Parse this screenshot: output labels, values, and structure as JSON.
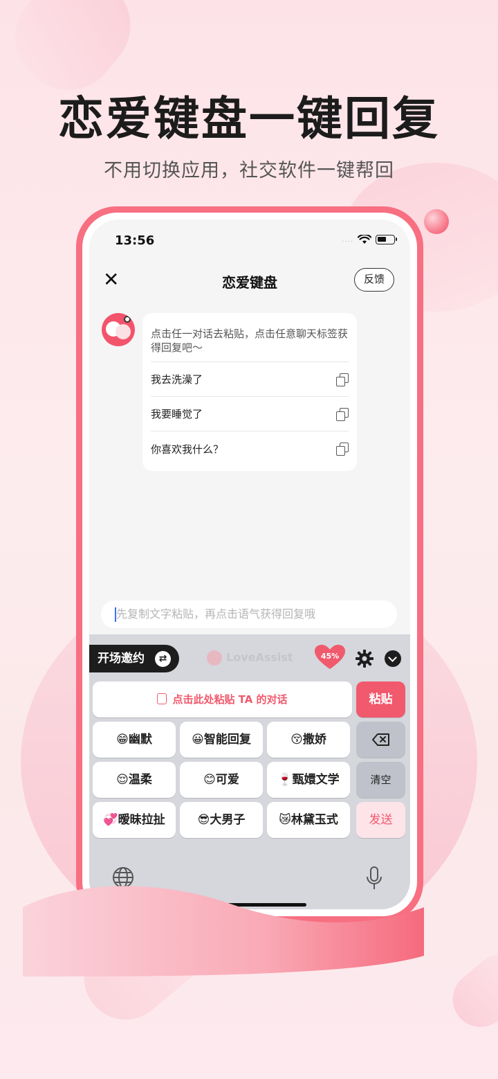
{
  "promo": {
    "headline": "恋爱键盘一键回复",
    "subline": "不用切换应用，社交软件一键帮回"
  },
  "status_bar": {
    "time": "13:56",
    "signal": "....",
    "icons": [
      "wifi-icon",
      "battery-icon"
    ]
  },
  "nav": {
    "close_label": "✕",
    "title": "恋爱键盘",
    "feedback_label": "反馈"
  },
  "chat": {
    "tip": "点击任一对话去粘贴，点击任意聊天标签获得回复吧～",
    "suggestions": [
      {
        "text": "我去洗澡了",
        "icon": "copy-icon"
      },
      {
        "text": "我要睡觉了",
        "icon": "copy-icon"
      },
      {
        "text": "你喜欢我什么？",
        "icon": "copy-icon"
      }
    ]
  },
  "input": {
    "placeholder": "先复制文字粘贴，再点击语气获得回复哦"
  },
  "keyboard": {
    "mode_label": "开场邀约",
    "swap_icon": "⇄",
    "brand": "LoveAssist",
    "love_meter": "45%",
    "paste_prompt": "点击此处粘贴 TA 的对话",
    "paste_label": "粘贴",
    "clear_label": "清空",
    "send_label": "发送",
    "tones": [
      {
        "emoji": "😁",
        "label": "幽默"
      },
      {
        "emoji": "😀",
        "label": "智能回复"
      },
      {
        "emoji": "😚",
        "label": "撒娇"
      },
      {
        "emoji": "😌",
        "label": "温柔"
      },
      {
        "emoji": "😊",
        "label": "可爱"
      },
      {
        "emoji": "🍷",
        "label": "甄嬛文学"
      },
      {
        "emoji": "💞",
        "label": "暧昧拉扯"
      },
      {
        "emoji": "😎",
        "label": "大男子"
      },
      {
        "emoji": "😿",
        "label": "林黛玉式"
      }
    ]
  },
  "colors": {
    "accent": "#f1596d",
    "phone_frame": "#f76f81",
    "background": "#fde6ea",
    "keyboard": "#d5d7dc"
  }
}
